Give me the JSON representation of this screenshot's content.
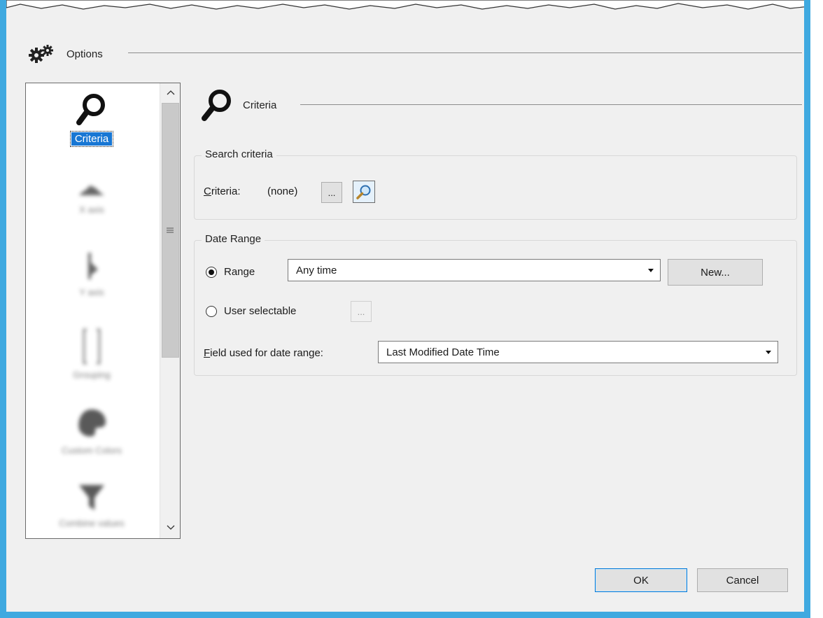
{
  "dialog": {
    "title": "Options",
    "section_title": "Criteria"
  },
  "nav": {
    "items": [
      {
        "label": "Criteria",
        "icon": "search-icon",
        "selected": true
      },
      {
        "label": "X axis",
        "icon": "x-axis-icon"
      },
      {
        "label": "Y axis",
        "icon": "y-axis-icon"
      },
      {
        "label": "Grouping",
        "icon": "grouping-icon"
      },
      {
        "label": "Custom Colors",
        "icon": "palette-icon"
      },
      {
        "label": "Combine values",
        "icon": "funnel-icon"
      }
    ],
    "scroll_grip": "≡"
  },
  "search_criteria": {
    "legend": "Search criteria",
    "criteria_label": "Criteria:",
    "criteria_mnemonic": "C",
    "criteria_rest": "riteria:",
    "criteria_value": "(none)",
    "browse_label": "..."
  },
  "date_range": {
    "legend": "Date Range",
    "range_label": "Range",
    "range_selected": true,
    "range_value": "Any time",
    "new_button": "New...",
    "user_selectable_label": "User selectable",
    "user_selectable_button": "...",
    "field_label": "Field used for date range:",
    "field_mnemonic": "F",
    "field_rest": "ield used for date range:",
    "field_value": "Last Modified Date Time"
  },
  "buttons": {
    "ok": "OK",
    "cancel": "Cancel"
  },
  "colors": {
    "frame_border": "#3fa9e0",
    "selection": "#1877d4",
    "dialog_bg": "#f0f0f0"
  }
}
